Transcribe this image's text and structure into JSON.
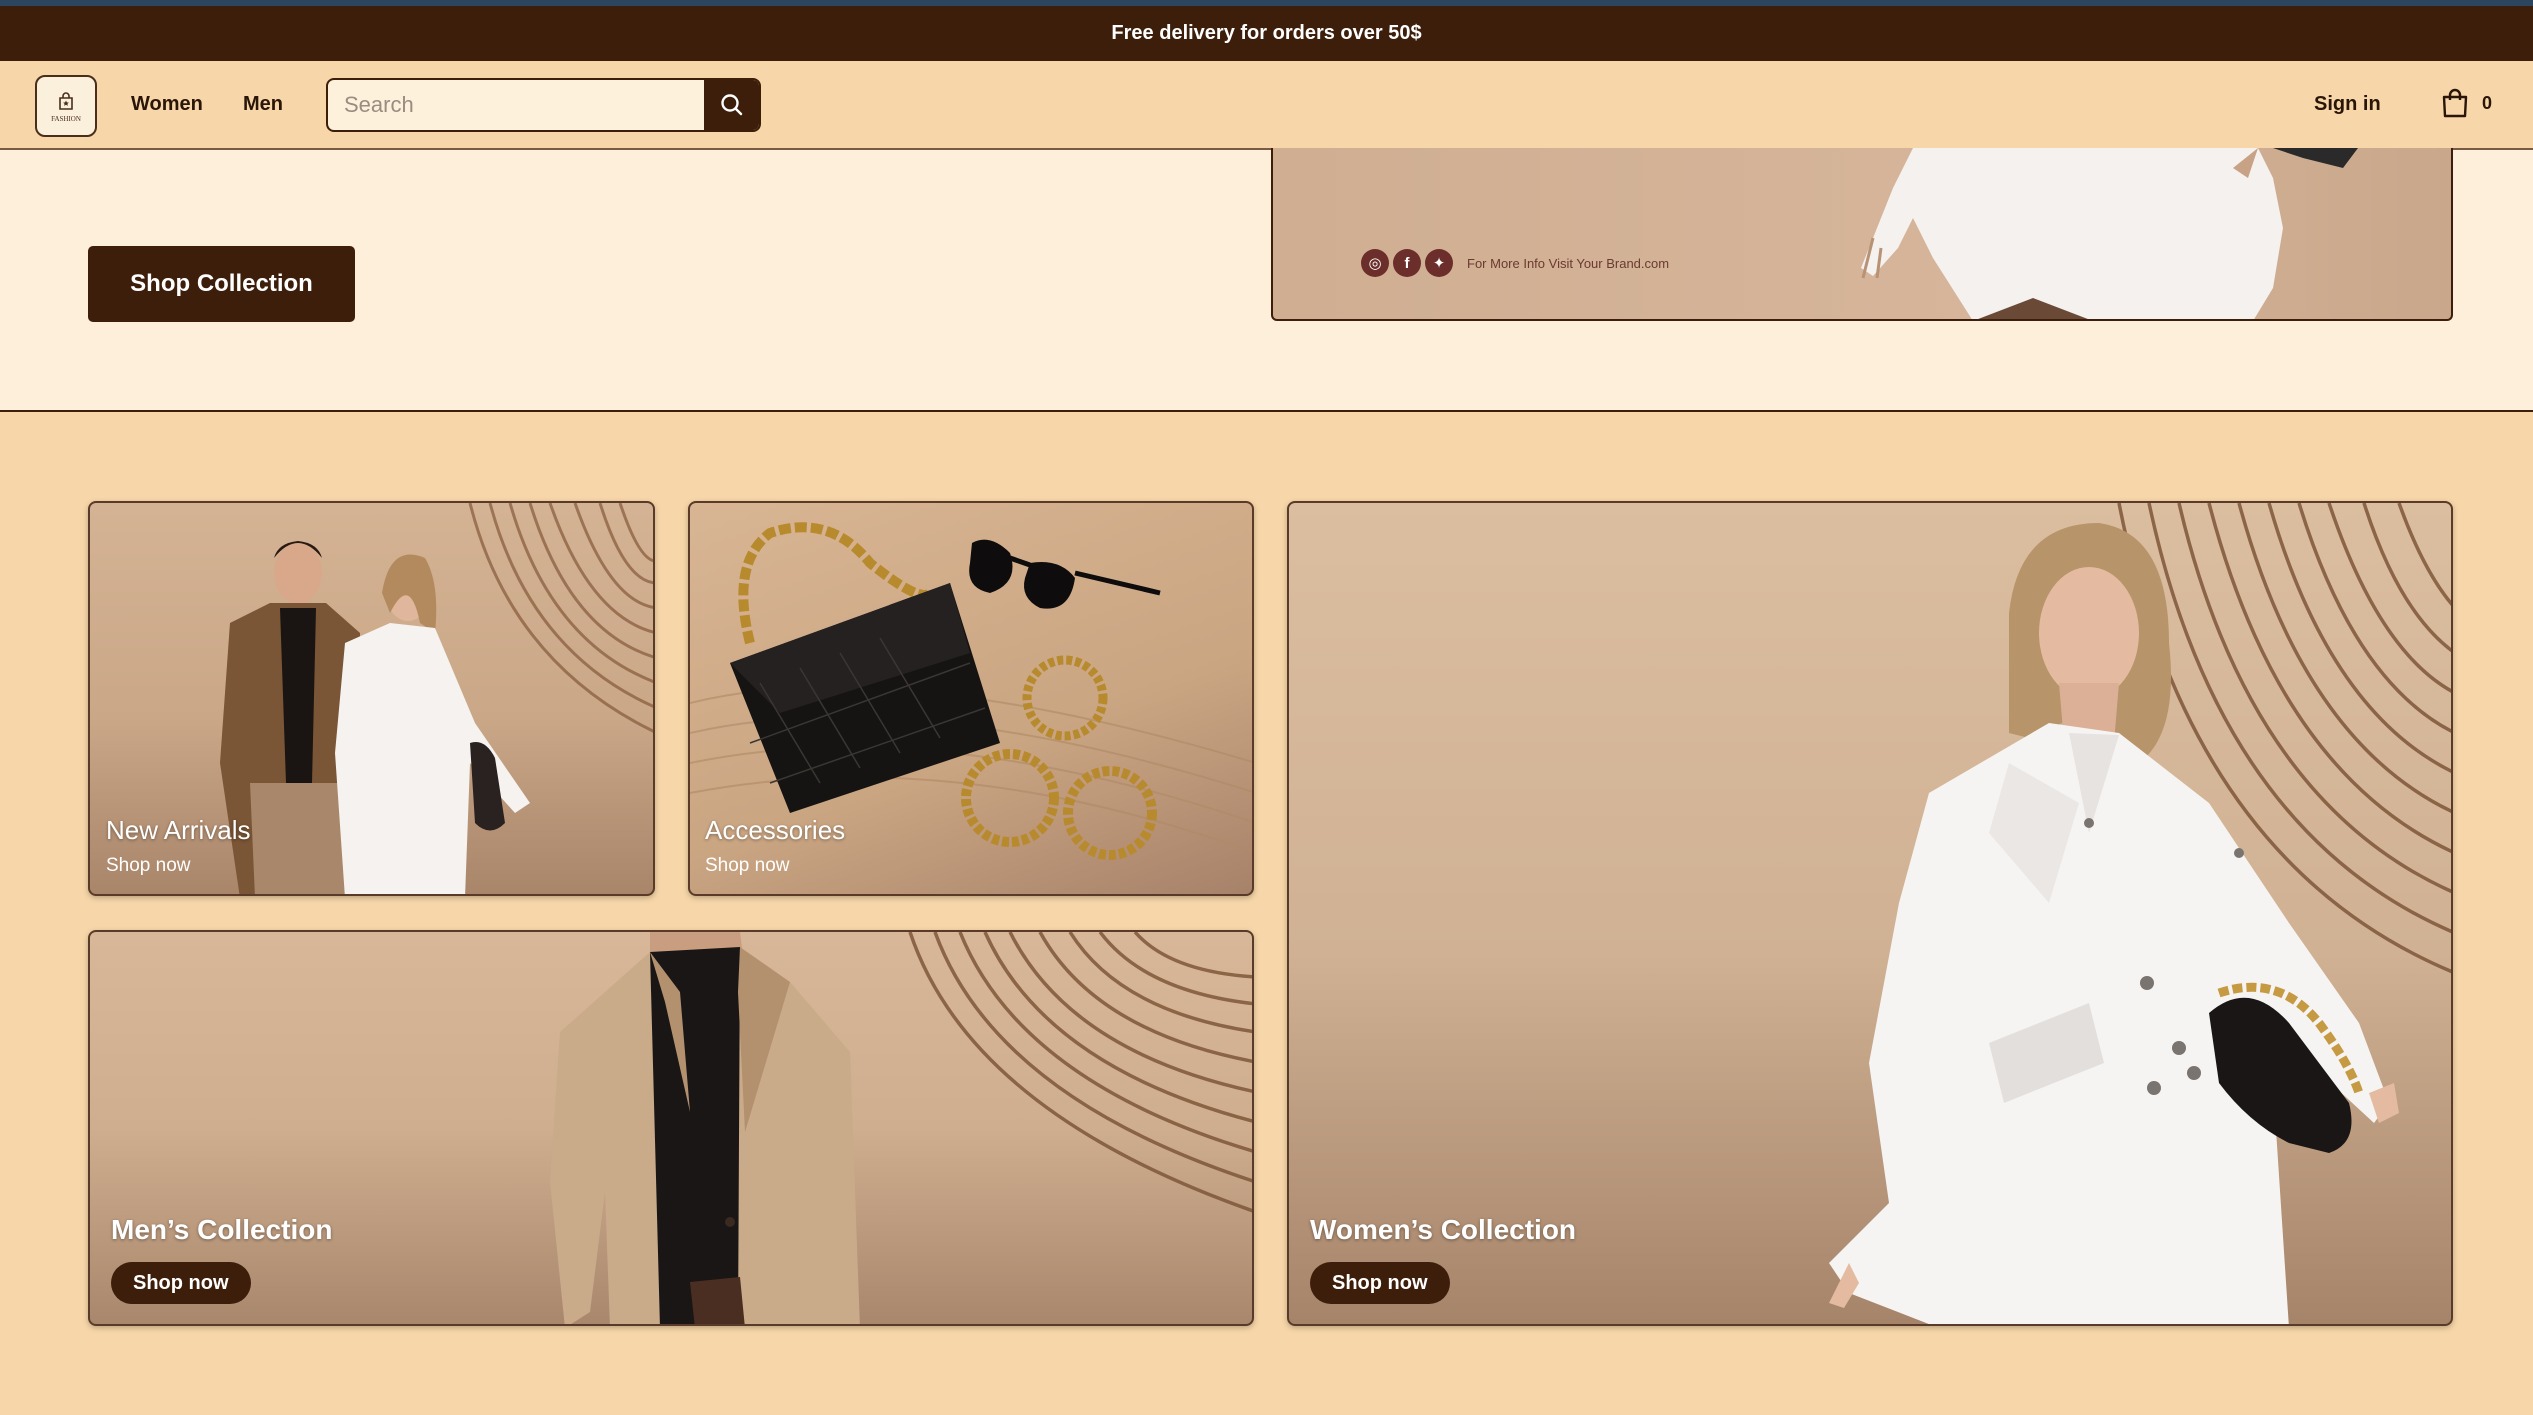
{
  "promo": {
    "text": "Free delivery for orders over 50$"
  },
  "logo": {
    "word": "FASHION"
  },
  "nav": {
    "women": "Women",
    "men": "Men",
    "sign_in": "Sign in"
  },
  "search": {
    "placeholder": "Search",
    "value": ""
  },
  "cart": {
    "count": "0"
  },
  "hero": {
    "cta": "Shop Collection",
    "banner_text": "For More Info Visit Your Brand.com",
    "social": [
      "instagram",
      "facebook",
      "twitter"
    ]
  },
  "cards": {
    "new_arrivals": {
      "title": "New Arrivals",
      "sub": "Shop now"
    },
    "accessories": {
      "title": "Accessories",
      "sub": "Shop now"
    },
    "men": {
      "title": "Men’s Collection",
      "button": "Shop now"
    },
    "women": {
      "title": "Women’s Collection",
      "button": "Shop now"
    }
  },
  "colors": {
    "brand_dark": "#3d1e0b",
    "page_bg": "#f7d7a9",
    "hero_bg": "#fdefd9",
    "card_tan": "#c9a283"
  }
}
